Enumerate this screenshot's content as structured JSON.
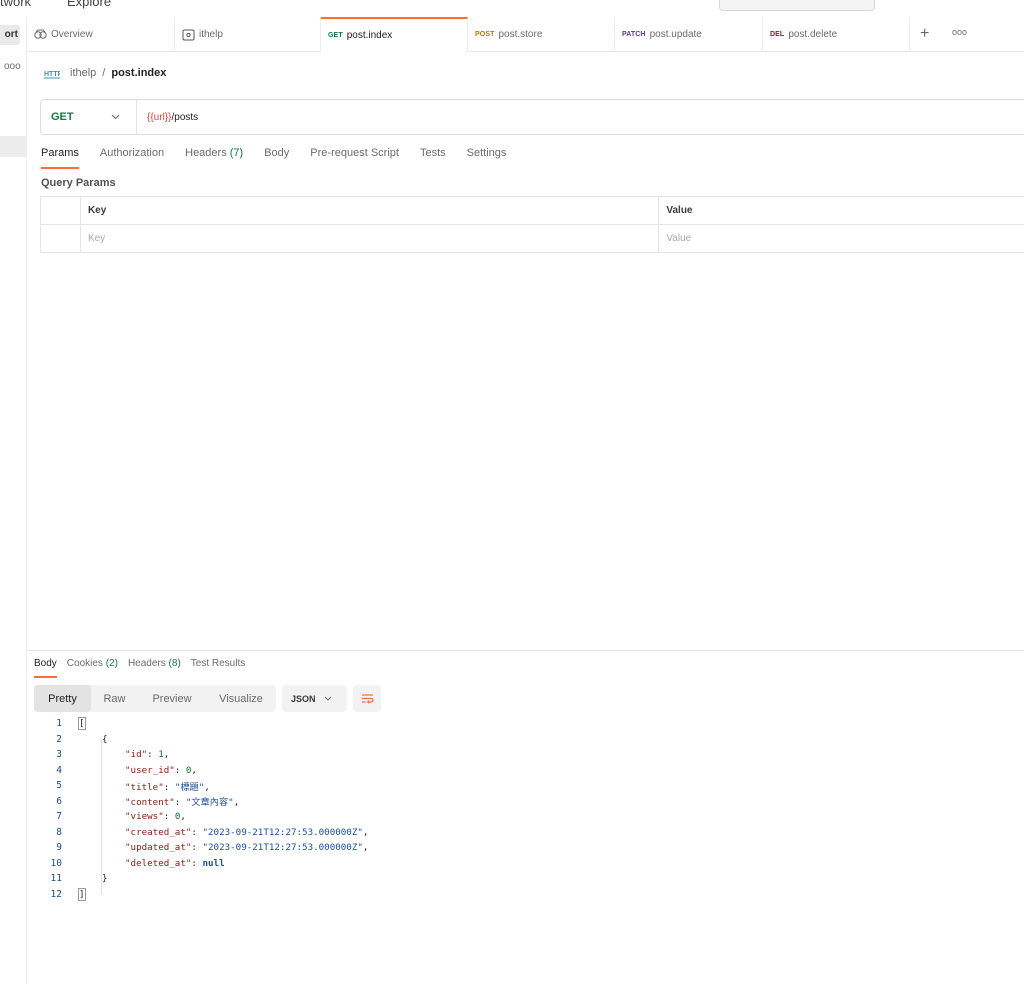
{
  "topbar": {
    "nav_left": "twork",
    "nav_explore": "Explore"
  },
  "sidebar": {
    "import_label": "ort",
    "more_label": "ooo"
  },
  "tabs": [
    {
      "label": "Overview",
      "method": "",
      "icon": "overview-icon"
    },
    {
      "label": "ithelp",
      "method": "",
      "icon": "collection-icon"
    },
    {
      "label": "post.index",
      "method": "GET",
      "active": true
    },
    {
      "label": "post.store",
      "method": "POST"
    },
    {
      "label": "post.update",
      "method": "PATCH"
    },
    {
      "label": "post.delete",
      "method": "DEL"
    }
  ],
  "tabs_more": "ooo",
  "breadcrumb": {
    "collection": "ithelp",
    "separator": "/",
    "request": "post.index"
  },
  "request": {
    "method": "GET",
    "url_variable": "{{url}}",
    "url_path": "/posts"
  },
  "request_tabs": [
    {
      "label": "Params",
      "count": "",
      "active": true
    },
    {
      "label": "Authorization",
      "count": ""
    },
    {
      "label": "Headers",
      "count": "(7)"
    },
    {
      "label": "Body",
      "count": ""
    },
    {
      "label": "Pre-request Script",
      "count": ""
    },
    {
      "label": "Tests",
      "count": ""
    },
    {
      "label": "Settings",
      "count": ""
    }
  ],
  "query_params": {
    "title": "Query Params",
    "headers": {
      "key": "Key",
      "value": "Value"
    },
    "placeholders": {
      "key": "Key",
      "value": "Value"
    }
  },
  "response_tabs": [
    {
      "label": "Body",
      "count": "",
      "active": true
    },
    {
      "label": "Cookies",
      "count": "(2)"
    },
    {
      "label": "Headers",
      "count": "(8)"
    },
    {
      "label": "Test Results",
      "count": ""
    }
  ],
  "view_modes": [
    {
      "label": "Pretty",
      "active": true
    },
    {
      "label": "Raw"
    },
    {
      "label": "Preview"
    },
    {
      "label": "Visualize"
    }
  ],
  "format": "JSON",
  "colors": {
    "accent": "#ff6c37",
    "get": "#0f7b3f",
    "post": "#ad7a03",
    "patch": "#623497",
    "delete": "#8e1a10"
  },
  "code_lines": [
    {
      "n": "1",
      "text": "["
    },
    {
      "n": "2",
      "text": "{"
    },
    {
      "n": "3",
      "key": "\"id\"",
      "value": "1",
      "type": "num",
      "comma": ","
    },
    {
      "n": "4",
      "key": "\"user_id\"",
      "value": "0",
      "type": "num",
      "comma": ","
    },
    {
      "n": "5",
      "key": "\"title\"",
      "value": "\"標題\"",
      "type": "str",
      "comma": ","
    },
    {
      "n": "6",
      "key": "\"content\"",
      "value": "\"文章內容\"",
      "type": "str",
      "comma": ","
    },
    {
      "n": "7",
      "key": "\"views\"",
      "value": "0",
      "type": "num",
      "comma": ","
    },
    {
      "n": "8",
      "key": "\"created_at\"",
      "value": "\"2023-09-21T12:27:53.000000Z\"",
      "type": "str",
      "comma": ","
    },
    {
      "n": "9",
      "key": "\"updated_at\"",
      "value": "\"2023-09-21T12:27:53.000000Z\"",
      "type": "str",
      "comma": ","
    },
    {
      "n": "10",
      "key": "\"deleted_at\"",
      "value": "null",
      "type": "null",
      "comma": ""
    },
    {
      "n": "11",
      "text": "}"
    },
    {
      "n": "12",
      "text": "]"
    }
  ]
}
